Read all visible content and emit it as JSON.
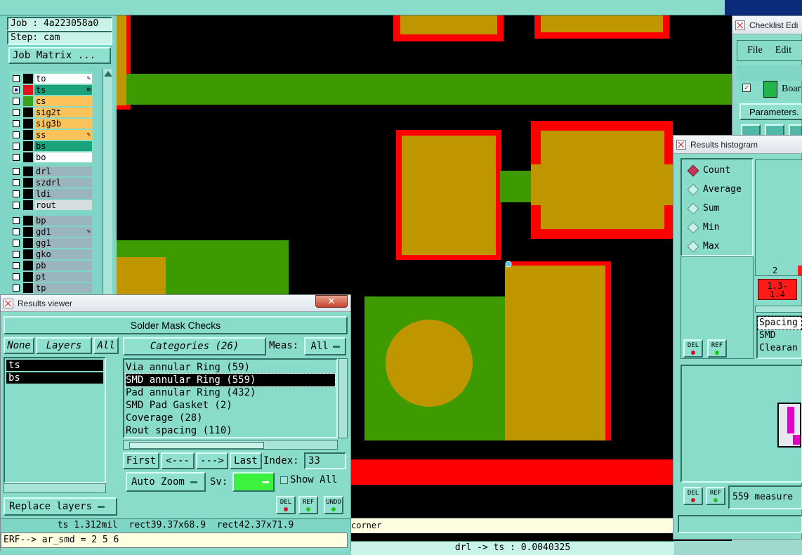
{
  "job": {
    "job_label": "Job : 4a223058a0",
    "step_label": "Step: cam",
    "matrix_button": "Job Matrix ..."
  },
  "layers_board": [
    {
      "name": "to",
      "color": "#ffffff",
      "swatch": "#000000",
      "selected": false,
      "marker": "✎"
    },
    {
      "name": "ts",
      "color": "#1aa37a",
      "swatch": "#e0141c",
      "selected": true,
      "marker": "⊞"
    },
    {
      "name": "cs",
      "color": "#ffc35c",
      "swatch": "#3aa01e",
      "selected": false,
      "marker": ""
    },
    {
      "name": "sig2t",
      "color": "#ffc35c",
      "swatch": "#000000",
      "selected": false,
      "marker": ""
    },
    {
      "name": "sig3b",
      "color": "#ffc35c",
      "swatch": "#000000",
      "selected": false,
      "marker": ""
    },
    {
      "name": "ss",
      "color": "#ffc35c",
      "swatch": "#000000",
      "selected": false,
      "marker": "✎"
    },
    {
      "name": "bs",
      "color": "#1aa37a",
      "swatch": "#000000",
      "selected": false,
      "marker": ""
    },
    {
      "name": "bo",
      "color": "#ffffff",
      "swatch": "#000000",
      "selected": false,
      "marker": ""
    }
  ],
  "layers_drill": [
    {
      "name": "drl",
      "color": "#9bb5bd",
      "swatch": "#000000",
      "marker": ""
    },
    {
      "name": "szdrl",
      "color": "#9bb5bd",
      "swatch": "#000000",
      "marker": ""
    },
    {
      "name": "ldi",
      "color": "#9bb5bd",
      "swatch": "#000000",
      "marker": ""
    },
    {
      "name": "rout",
      "color": "#d7dedf",
      "swatch": "#000000",
      "marker": ""
    }
  ],
  "layers_misc": [
    {
      "name": "bp",
      "color": "#9bb5bd",
      "swatch": "#000000",
      "marker": ""
    },
    {
      "name": "gd1",
      "color": "#9bb5bd",
      "swatch": "#000000",
      "marker": "✎"
    },
    {
      "name": "gg1",
      "color": "#9bb5bd",
      "swatch": "#000000",
      "marker": ""
    },
    {
      "name": "gko",
      "color": "#9bb5bd",
      "swatch": "#000000",
      "marker": ""
    },
    {
      "name": "pb",
      "color": "#9bb5bd",
      "swatch": "#000000",
      "marker": ""
    },
    {
      "name": "pt",
      "color": "#9bb5bd",
      "swatch": "#000000",
      "marker": ""
    },
    {
      "name": "tp",
      "color": "#9bb5bd",
      "swatch": "#000000",
      "marker": ""
    }
  ],
  "results_viewer": {
    "window_title": "Results viewer",
    "header": "Solder Mask Checks",
    "none_btn": "None",
    "layers_btn": "Layers",
    "all_btn": "All",
    "layer_list": [
      "ts",
      "bs"
    ],
    "categories_btn": "Categories (26)",
    "meas_label": "Meas:",
    "meas_value": "All",
    "categories": [
      "Via annular Ring (59)",
      "SMD annular Ring (559)",
      "Pad annular Ring (432)",
      "SMD Pad Gasket (2)",
      "Coverage (28)",
      "Rout spacing (110)"
    ],
    "selected_category": 1,
    "first_btn": "First",
    "prev_btn": "<---",
    "next_btn": "--->",
    "last_btn": "Last",
    "index_label": "Index:",
    "index_value": "33",
    "zoom_value": "Auto Zoom",
    "sv_label": "Sv:",
    "show_all_label": "Show All",
    "replace_layers": "Replace layers",
    "del_label": "DEL",
    "ref_label": "REF",
    "undo_label": "UNDO",
    "status_line": "ts 1.312mil  rect39.37x68.9  rect42.37x71.9",
    "cmd_line": "ERF--> ar_smd = 2 5 6"
  },
  "canvas": {
    "bottom_text_right": "corner",
    "status_text": "drl -> ts : 0.0040325",
    "colors": {
      "background": "#000000",
      "pad": "#bf9600",
      "mask": "#ff0000",
      "copper": "#3d9a00"
    }
  },
  "checklist": {
    "window_title": "Checklist Edi",
    "menu_file": "File",
    "menu_edit": "Edit",
    "board_label": "Boar",
    "params_btn": "Parameters."
  },
  "histogram": {
    "window_title": "Results histogram",
    "options": [
      "Count",
      "Average",
      "Sum",
      "Min",
      "Max"
    ],
    "selected": 0,
    "axis_value": "2",
    "range_label": "1.3-\n1.4",
    "list_items": [
      "Spacing",
      "SMD",
      "Clearan"
    ],
    "del_label": "DEL",
    "ref_label": "REF",
    "measure_text": "559 measure"
  }
}
